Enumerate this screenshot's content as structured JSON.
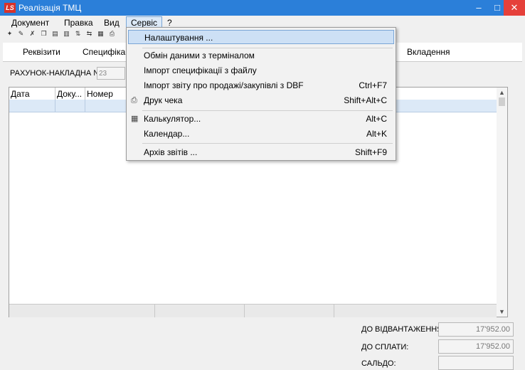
{
  "window": {
    "title": "Реалізація ТМЦ",
    "app_icon_text": "LS"
  },
  "menubar": {
    "items": [
      "Документ",
      "Правка",
      "Вид",
      "Сервіс",
      "?"
    ]
  },
  "tabs": {
    "left1": "Реквізити",
    "left2": "Специфікац",
    "right": "Вкладення"
  },
  "document": {
    "label": "РАХУНОК-НАКЛАДНА №:",
    "number": "23"
  },
  "grid": {
    "columns": [
      "Дата",
      "Доку...",
      "Номер"
    ]
  },
  "summary": {
    "shipment_label": "ДО ВІДВАНТАЖЕННЯ",
    "shipment_value": "17'952.00",
    "payment_label": "ДО СПЛАТИ:",
    "payment_value": "17'952.00",
    "balance_label": "САЛЬДО:",
    "balance_value": ""
  },
  "dropdown": {
    "items": [
      {
        "label": "Налаштування ...",
        "shortcut": ""
      },
      {
        "label": "Обмін даними з терміналом",
        "shortcut": ""
      },
      {
        "label": "Імпорт специфікації з файлу",
        "shortcut": ""
      },
      {
        "label": "Імпорт звіту про продажі/закупівлі з DBF",
        "shortcut": "Ctrl+F7"
      },
      {
        "label": "Друк чека",
        "shortcut": "Shift+Alt+C"
      },
      {
        "label": "Калькулятор...",
        "shortcut": "Alt+C"
      },
      {
        "label": "Календар...",
        "shortcut": "Alt+K"
      },
      {
        "label": "Архів звітів ...",
        "shortcut": "Shift+F9"
      }
    ]
  },
  "icons": {
    "print": "printer-icon",
    "calculator": "calculator-icon",
    "minimize": "minimize-icon",
    "maximize": "maximize-icon",
    "close": "close-icon"
  },
  "colors": {
    "titlebar": "#2b7fd9",
    "highlight": "#cde0f5",
    "close": "#e5403a"
  }
}
